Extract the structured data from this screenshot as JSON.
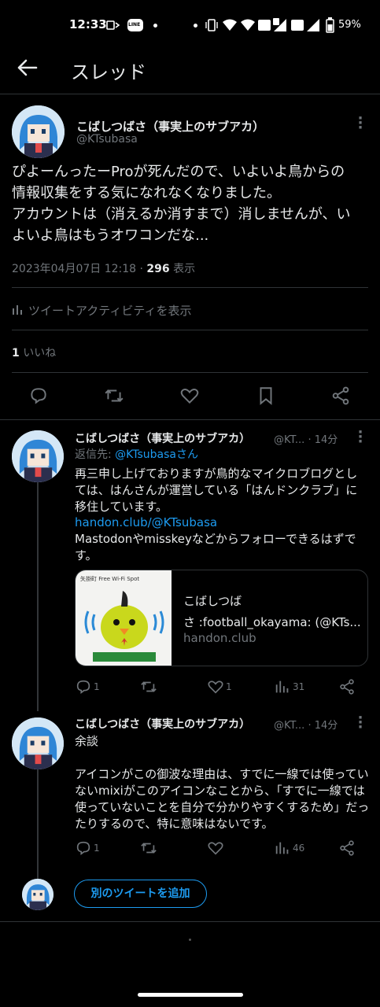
{
  "status_bar": {
    "time": "12:33",
    "battery": "59%",
    "line_badge": "LINE"
  },
  "header": {
    "title": "スレッド"
  },
  "main_tweet": {
    "name": "こばしつばさ（事実上のサブアカ）",
    "handle": "@KTsubasa",
    "text_lines": [
      "ぴよーんったーProが死んだので、いよいよ鳥からの",
      "情報収集をする気になれなくなりました。",
      "アカウントは（消えるか消すまで）消しませんが、い",
      "よいよ鳥はもうオワコンだな..."
    ],
    "timestamp": "2023年04月07日 12:18 · ",
    "views_count": "296",
    "views_label": " 表示",
    "activity_label": "ツイートアクティビティを表示",
    "likes_count": "1",
    "likes_label": " いいね"
  },
  "reply1": {
    "name": "こばしつばさ（事実上のサブアカ）",
    "handle_time": "@KT... · 14分",
    "reply_to_prefix": "返信先: ",
    "reply_to_user": "@KTsubasaさん",
    "text1": "再三申し上げておりますが鳥的なマイクロブログとしては、はんさんが運営している「はんドンクラブ」に移住しています。",
    "link": "handon.club/@KTsubasa",
    "text2": "Mastodonやmisskeyなどからフォローできるはずです。",
    "card": {
      "image_caption": "矢掛町 Free Wi-Fi Spot",
      "title_line1": "こばしつば",
      "title_line2": "さ :football_okayama: (@KTs...",
      "domain": "handon.club"
    },
    "actions": {
      "reply_count": "1",
      "like_count": "1",
      "views_count": "31"
    }
  },
  "reply2": {
    "name": "こばしつばさ（事実上のサブアカ）",
    "handle_time": "@KT... · 14分",
    "line1": "余談",
    "text": "アイコンがこの御波な理由は、すでに一線では使っていないmixiがこのアイコンなことから、「すでに一線では使っていないことを自分で分かりやすくするため」だったりするので、特に意味はないです。",
    "actions": {
      "reply_count": "1",
      "views_count": "46"
    }
  },
  "add_tweet_button": "別のツイートを追加",
  "colors": {
    "background": "#000000",
    "accent": "#1d9bf0",
    "secondary_text": "#71767b",
    "divider": "#2f3336"
  }
}
